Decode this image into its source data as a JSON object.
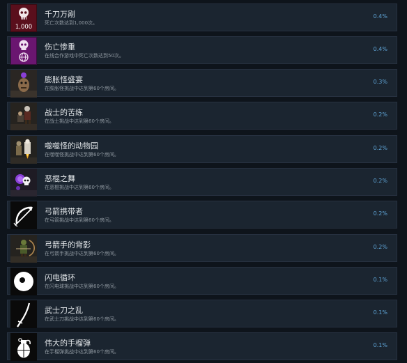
{
  "achievements": [
    {
      "icon": "skull-1000-icon",
      "title": "千刀万剐",
      "desc": "死亡次数达到1,000次。",
      "pct": "0.4%",
      "badge": "1,000"
    },
    {
      "icon": "skull-globe-icon",
      "title": "伤亡惨重",
      "desc": "在线合作游戏中死亡次数达到50次。",
      "pct": "0.4%"
    },
    {
      "icon": "bloated-monster-icon",
      "title": "膨胀怪盛宴",
      "desc": "在膨胀怪挑战中达到第60个房间。",
      "pct": "0.3%"
    },
    {
      "icon": "warrior-icon",
      "title": "战士的苦练",
      "desc": "在战士挑战中达到第60个房间。",
      "pct": "0.2%"
    },
    {
      "icon": "zoo-creature-icon",
      "title": "噬噬怪的动物园",
      "desc": "在噬噬怪挑战中达到第60个房间。",
      "pct": "0.2%"
    },
    {
      "icon": "purple-skull-icon",
      "title": "恶棍之舞",
      "desc": "在恶棍挑战中达到第60个房间。",
      "pct": "0.2%"
    },
    {
      "icon": "bow-arrow-icon",
      "title": "弓箭携带者",
      "desc": "在弓箭挑战中达到第60个房间。",
      "pct": "0.2%"
    },
    {
      "icon": "archer-icon",
      "title": "弓箭手的背影",
      "desc": "在弓箭手挑战中达到第60个房间。",
      "pct": "0.2%"
    },
    {
      "icon": "lightning-orb-icon",
      "title": "闪电循环",
      "desc": "在闪电球挑战中达到第60个房间。",
      "pct": "0.1%"
    },
    {
      "icon": "katana-icon",
      "title": "武士刀之乱",
      "desc": "在武士刀挑战中达到第60个房间。",
      "pct": "0.1%"
    },
    {
      "icon": "grenade-icon",
      "title": "伟大的手榴弹",
      "desc": "在手榴弹挑战中达到第60个房间。",
      "pct": "0.1%"
    }
  ]
}
